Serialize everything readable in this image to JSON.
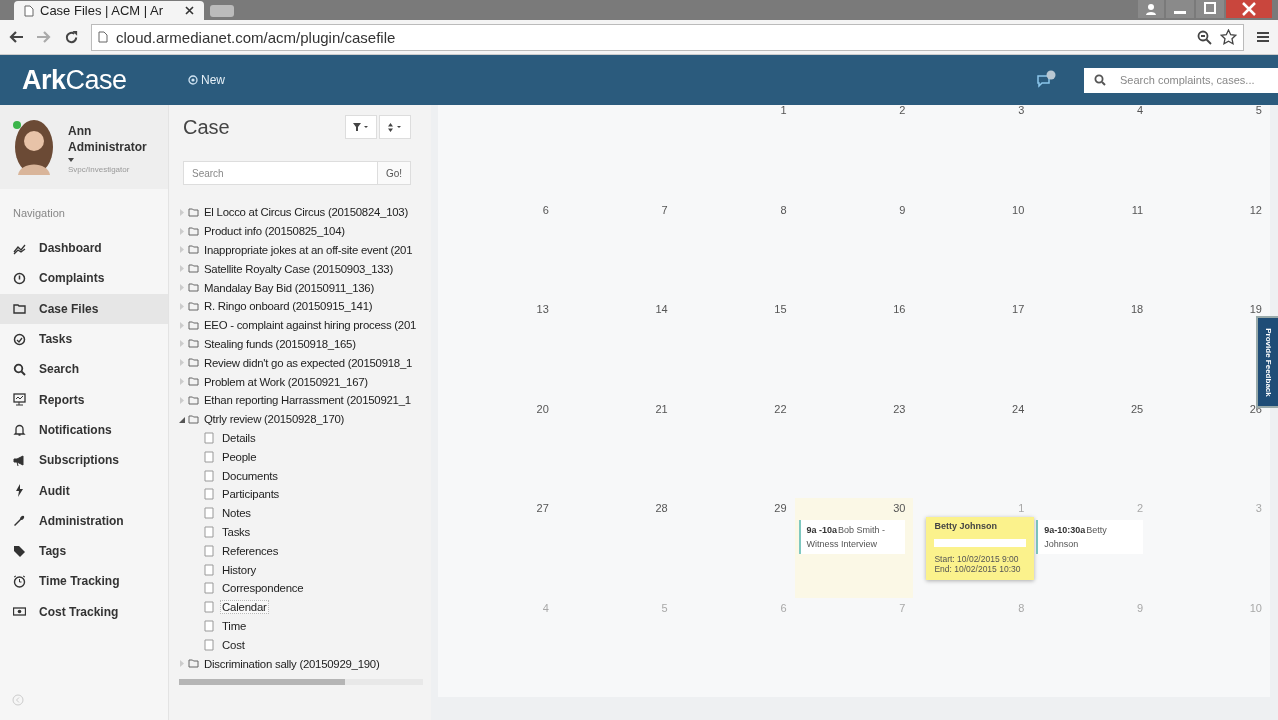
{
  "browser": {
    "tab_title": "Case Files | ACM | Ar",
    "url": "cloud.armedianet.com/acm/plugin/casefile"
  },
  "header": {
    "logo": "ArkCase",
    "new_label": "New",
    "search_placeholder": "Search complaints, cases..."
  },
  "user": {
    "name": "Ann Administrator",
    "role": "Svpc/Investigator",
    "online": true
  },
  "nav": {
    "heading": "Navigation",
    "items": [
      {
        "label": "Dashboard",
        "selected": false
      },
      {
        "label": "Complaints",
        "selected": false
      },
      {
        "label": "Case Files",
        "selected": true
      },
      {
        "label": "Tasks",
        "selected": false
      },
      {
        "label": "Search",
        "selected": false
      },
      {
        "label": "Reports",
        "selected": false
      },
      {
        "label": "Notifications",
        "selected": false
      },
      {
        "label": "Subscriptions",
        "selected": false
      },
      {
        "label": "Audit",
        "selected": false
      },
      {
        "label": "Administration",
        "selected": false
      },
      {
        "label": "Tags",
        "selected": false
      },
      {
        "label": "Time Tracking",
        "selected": false
      },
      {
        "label": "Cost Tracking",
        "selected": false
      }
    ]
  },
  "case_panel": {
    "title": "Case",
    "search_placeholder": "Search",
    "go_label": "Go!",
    "tree": [
      {
        "label": "El Locco at Circus Circus (20150824_103)",
        "expanded": false
      },
      {
        "label": "Product info (20150825_104)",
        "expanded": false
      },
      {
        "label": "Inappropriate jokes at an off-site event (201",
        "expanded": false
      },
      {
        "label": "Satellite Royalty Case (20150903_133)",
        "expanded": false
      },
      {
        "label": "Mandalay Bay Bid (20150911_136)",
        "expanded": false
      },
      {
        "label": "R. Ringo onboard (20150915_141)",
        "expanded": false
      },
      {
        "label": "EEO - complaint against hiring process (201",
        "expanded": false
      },
      {
        "label": "Stealing funds (20150918_165)",
        "expanded": false
      },
      {
        "label": "Review didn't go as expected (20150918_1",
        "expanded": false
      },
      {
        "label": "Problem at Work (20150921_167)",
        "expanded": false
      },
      {
        "label": "Ethan reporting Harrassment (20150921_1",
        "expanded": false
      },
      {
        "label": "Qtrly review (20150928_170)",
        "expanded": true,
        "children": [
          {
            "label": "Details",
            "selected": false
          },
          {
            "label": "People",
            "selected": false
          },
          {
            "label": "Documents",
            "selected": false
          },
          {
            "label": "Participants",
            "selected": false
          },
          {
            "label": "Notes",
            "selected": false
          },
          {
            "label": "Tasks",
            "selected": false
          },
          {
            "label": "References",
            "selected": false
          },
          {
            "label": "History",
            "selected": false
          },
          {
            "label": "Correspondence",
            "selected": false
          },
          {
            "label": "Calendar",
            "selected": true
          },
          {
            "label": "Time",
            "selected": false
          },
          {
            "label": "Cost",
            "selected": false
          }
        ]
      },
      {
        "label": "Discrimination sally (20150929_190)",
        "expanded": false
      }
    ]
  },
  "calendar": {
    "weeks": [
      [
        {
          "day": "1",
          "faded": false
        },
        {
          "day": "2",
          "faded": false
        },
        {
          "day": "3",
          "faded": false
        },
        {
          "day": "4",
          "faded": false
        },
        {
          "day": "5",
          "faded": false
        }
      ],
      [
        {
          "day": "6",
          "faded": false
        },
        {
          "day": "7",
          "faded": false
        },
        {
          "day": "8",
          "faded": false
        },
        {
          "day": "9",
          "faded": false
        },
        {
          "day": "10",
          "faded": false
        },
        {
          "day": "11",
          "faded": false
        },
        {
          "day": "12",
          "faded": false
        }
      ],
      [
        {
          "day": "13",
          "faded": false
        },
        {
          "day": "14",
          "faded": false
        },
        {
          "day": "15",
          "faded": false
        },
        {
          "day": "16",
          "faded": false
        },
        {
          "day": "17",
          "faded": false
        },
        {
          "day": "18",
          "faded": false
        },
        {
          "day": "19",
          "faded": false
        }
      ],
      [
        {
          "day": "20",
          "faded": false
        },
        {
          "day": "21",
          "faded": false
        },
        {
          "day": "22",
          "faded": false
        },
        {
          "day": "23",
          "faded": false
        },
        {
          "day": "24",
          "faded": false
        },
        {
          "day": "25",
          "faded": false
        },
        {
          "day": "26",
          "faded": false
        }
      ],
      [
        {
          "day": "27",
          "faded": false
        },
        {
          "day": "28",
          "faded": false
        },
        {
          "day": "29",
          "faded": false
        },
        {
          "day": "30",
          "faded": false,
          "today": true,
          "events": [
            {
              "time": "9a -10a",
              "title": "Bob Smith - Witness Interview"
            }
          ]
        },
        {
          "day": "1",
          "faded": true,
          "popover": {
            "title": "Betty Johnson",
            "start": "Start: 10/02/2015 9:00",
            "end": "End: 10/02/2015 10:30"
          }
        },
        {
          "day": "2",
          "faded": true,
          "events": [
            {
              "time": "9a-10:30a",
              "title": "Betty Johnson"
            }
          ]
        },
        {
          "day": "3",
          "faded": true
        }
      ],
      [
        {
          "day": "4",
          "faded": true
        },
        {
          "day": "5",
          "faded": true
        },
        {
          "day": "6",
          "faded": true
        },
        {
          "day": "7",
          "faded": true
        },
        {
          "day": "8",
          "faded": true
        },
        {
          "day": "9",
          "faded": true
        },
        {
          "day": "10",
          "faded": true
        }
      ]
    ]
  },
  "feedback": "Provide Feedback"
}
